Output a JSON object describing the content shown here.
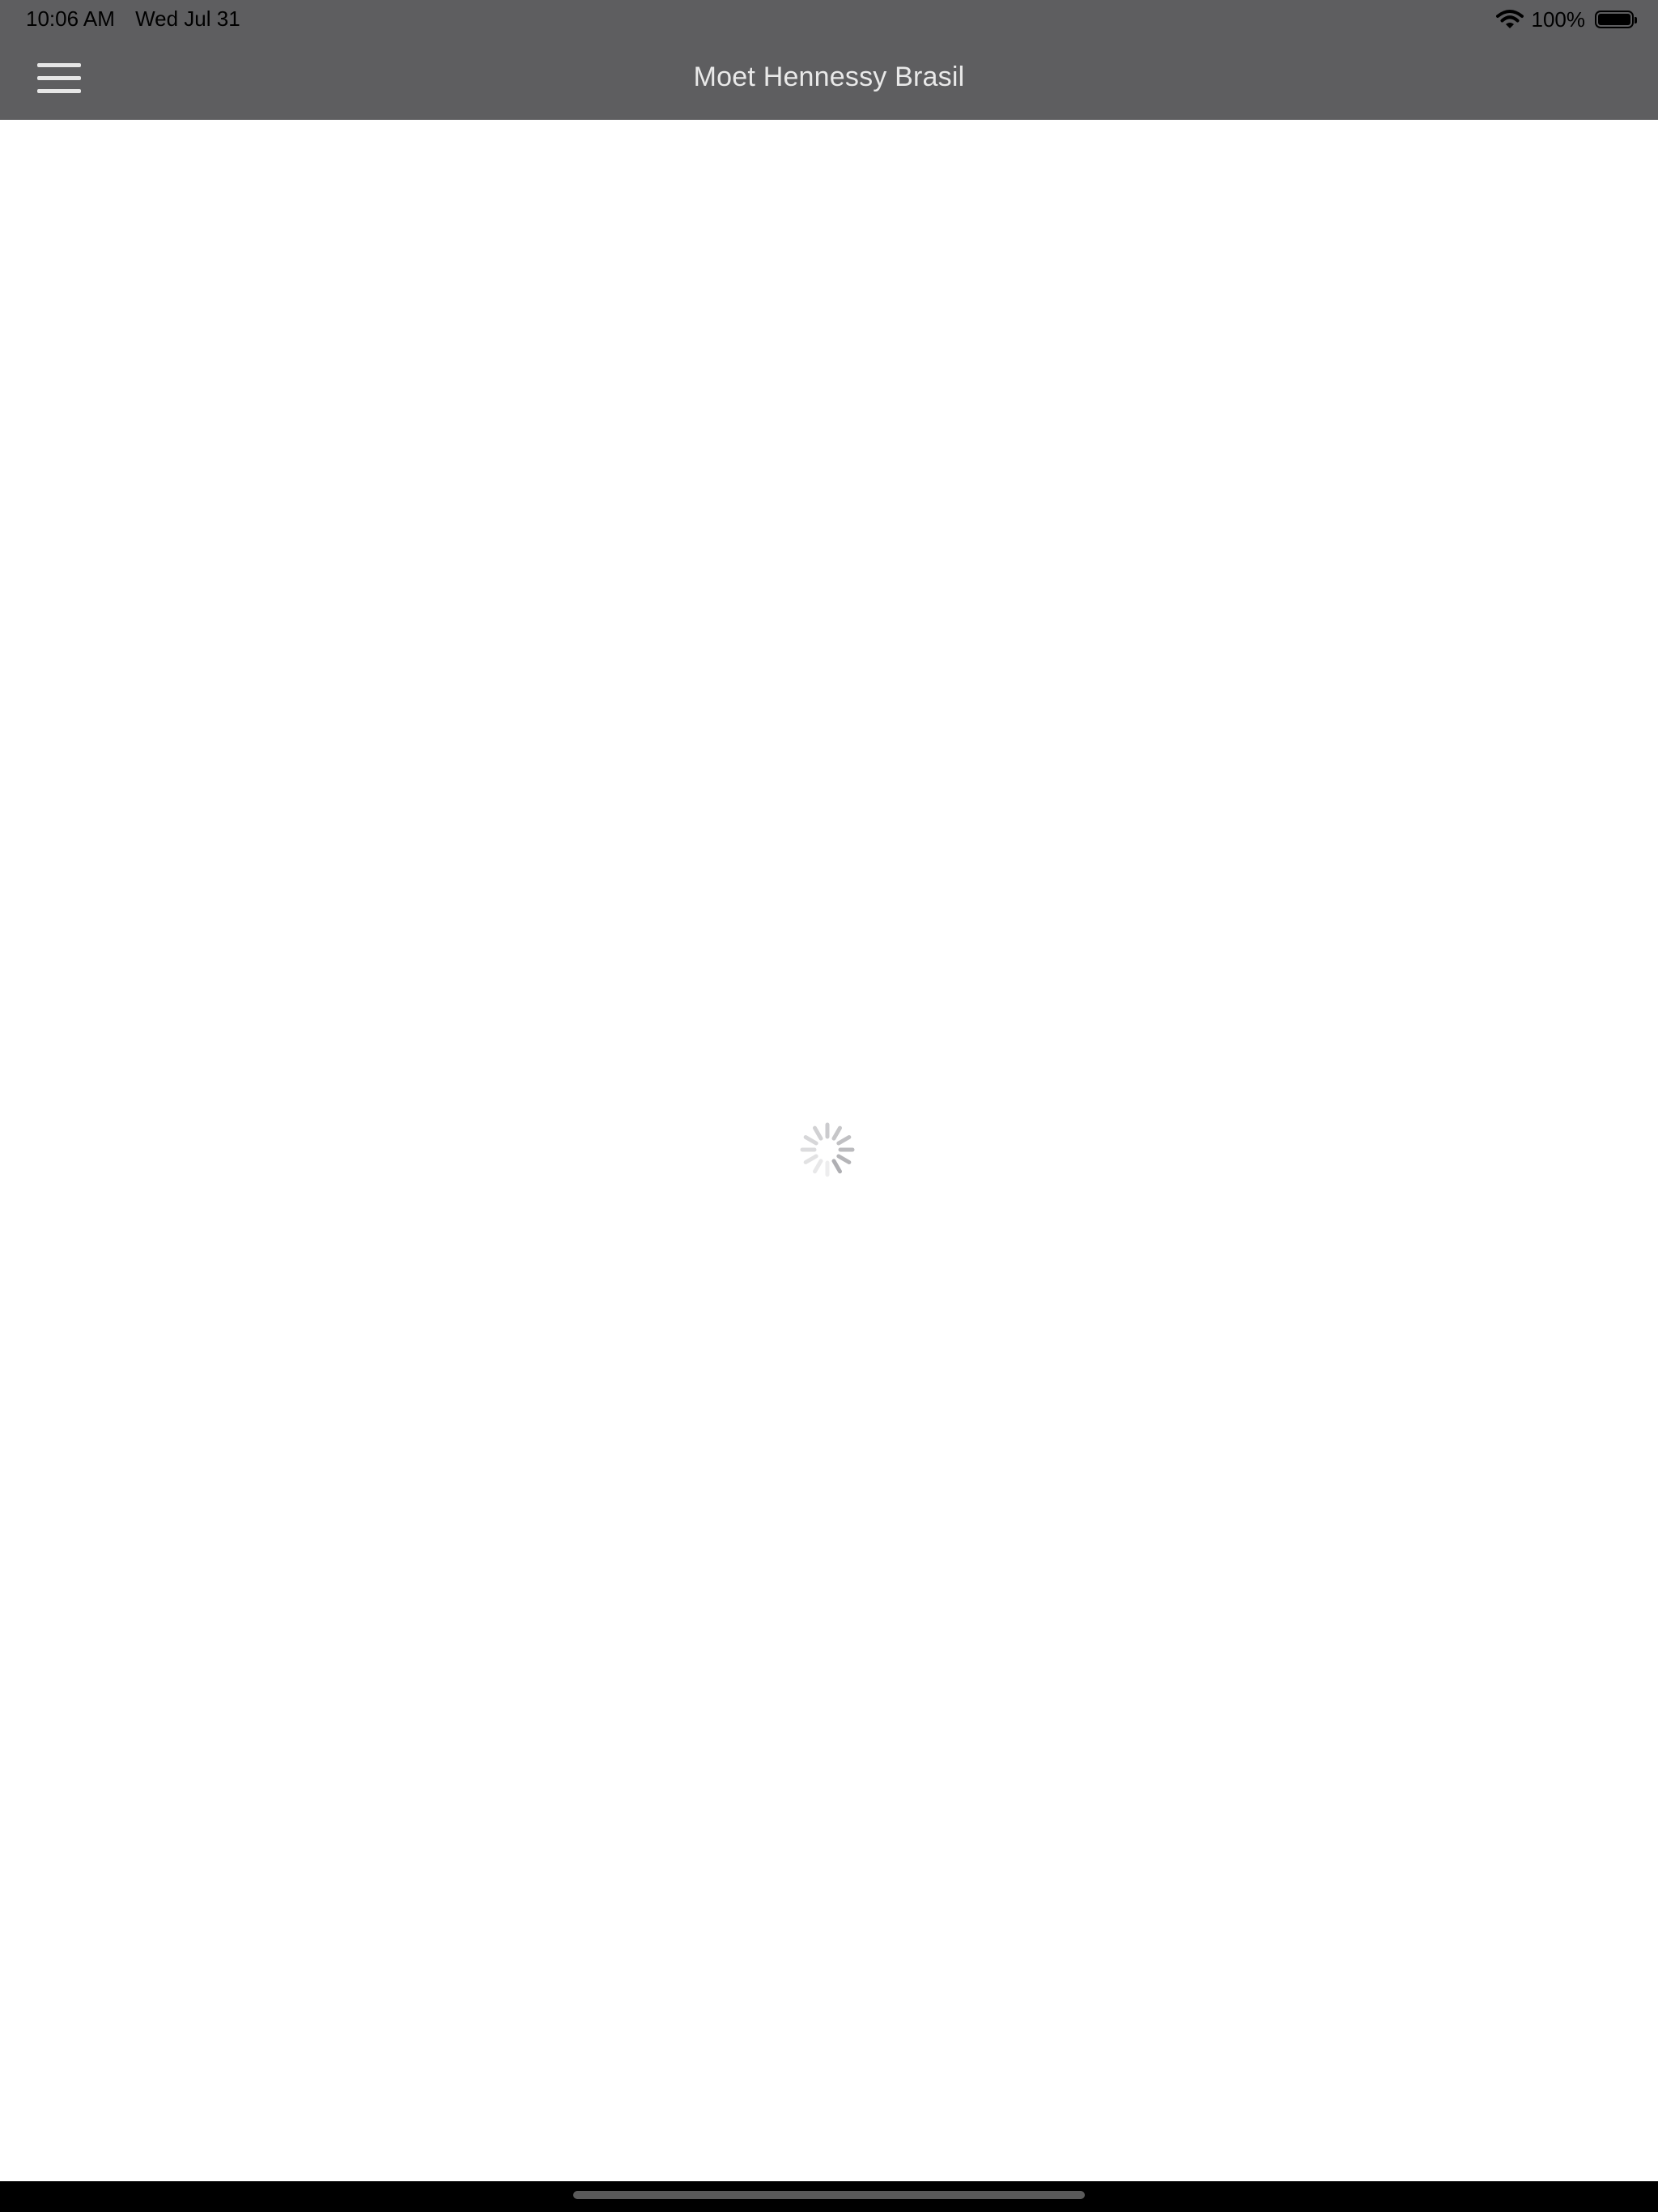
{
  "status_bar": {
    "time": "10:06 AM",
    "date": "Wed Jul 31",
    "battery_percent": "100%",
    "battery_level": 1.0,
    "icons": [
      "wifi-icon",
      "battery-icon"
    ]
  },
  "nav_bar": {
    "title": "Moet Hennessy Brasil",
    "menu_icon": "hamburger-menu-icon"
  },
  "content": {
    "state_icon": "loading-spinner-icon"
  },
  "colors": {
    "nav_background": "#5e5e60",
    "nav_text": "#e9e9e9",
    "content_background": "#ffffff",
    "home_strip": "#000000"
  }
}
